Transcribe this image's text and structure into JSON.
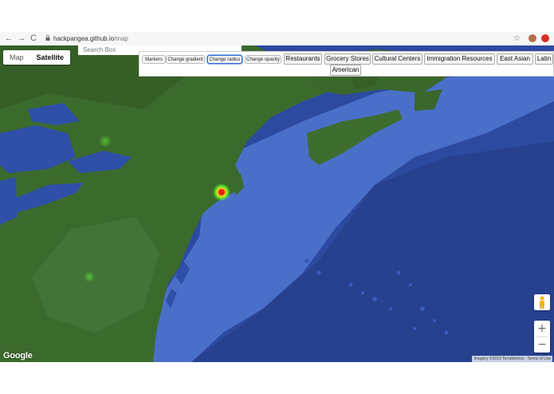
{
  "browser": {
    "url_host": "hackpangea.github.io",
    "url_path": "/map",
    "back_icon": "←",
    "forward_icon": "→",
    "reload_icon": "C",
    "star_icon": "☆"
  },
  "map": {
    "type_control": {
      "map": "Map",
      "satellite": "Satellite",
      "selected": "Satellite"
    },
    "search_placeholder": "Search Box",
    "heatmap_controls": {
      "markers": "Markers",
      "change_gradient": "Change gradient",
      "change_radius": "Change radius",
      "change_opacity": "Change opacity"
    },
    "categories": [
      "Restaurants",
      "Grocery Stores",
      "Cultural Centers",
      "Immigration Resources",
      "East Asian",
      "Latin",
      "American"
    ],
    "zoom_in": "+",
    "zoom_out": "−",
    "logo": "Google",
    "attribution": [
      "Imagery ©2019 TerraMetrics",
      "Terms of Use"
    ],
    "colors": {
      "ocean": "#2d4aa1",
      "land": "#3b6b2c",
      "heat_center": "#e0201a",
      "heat_glow": "#5cff2a"
    }
  }
}
